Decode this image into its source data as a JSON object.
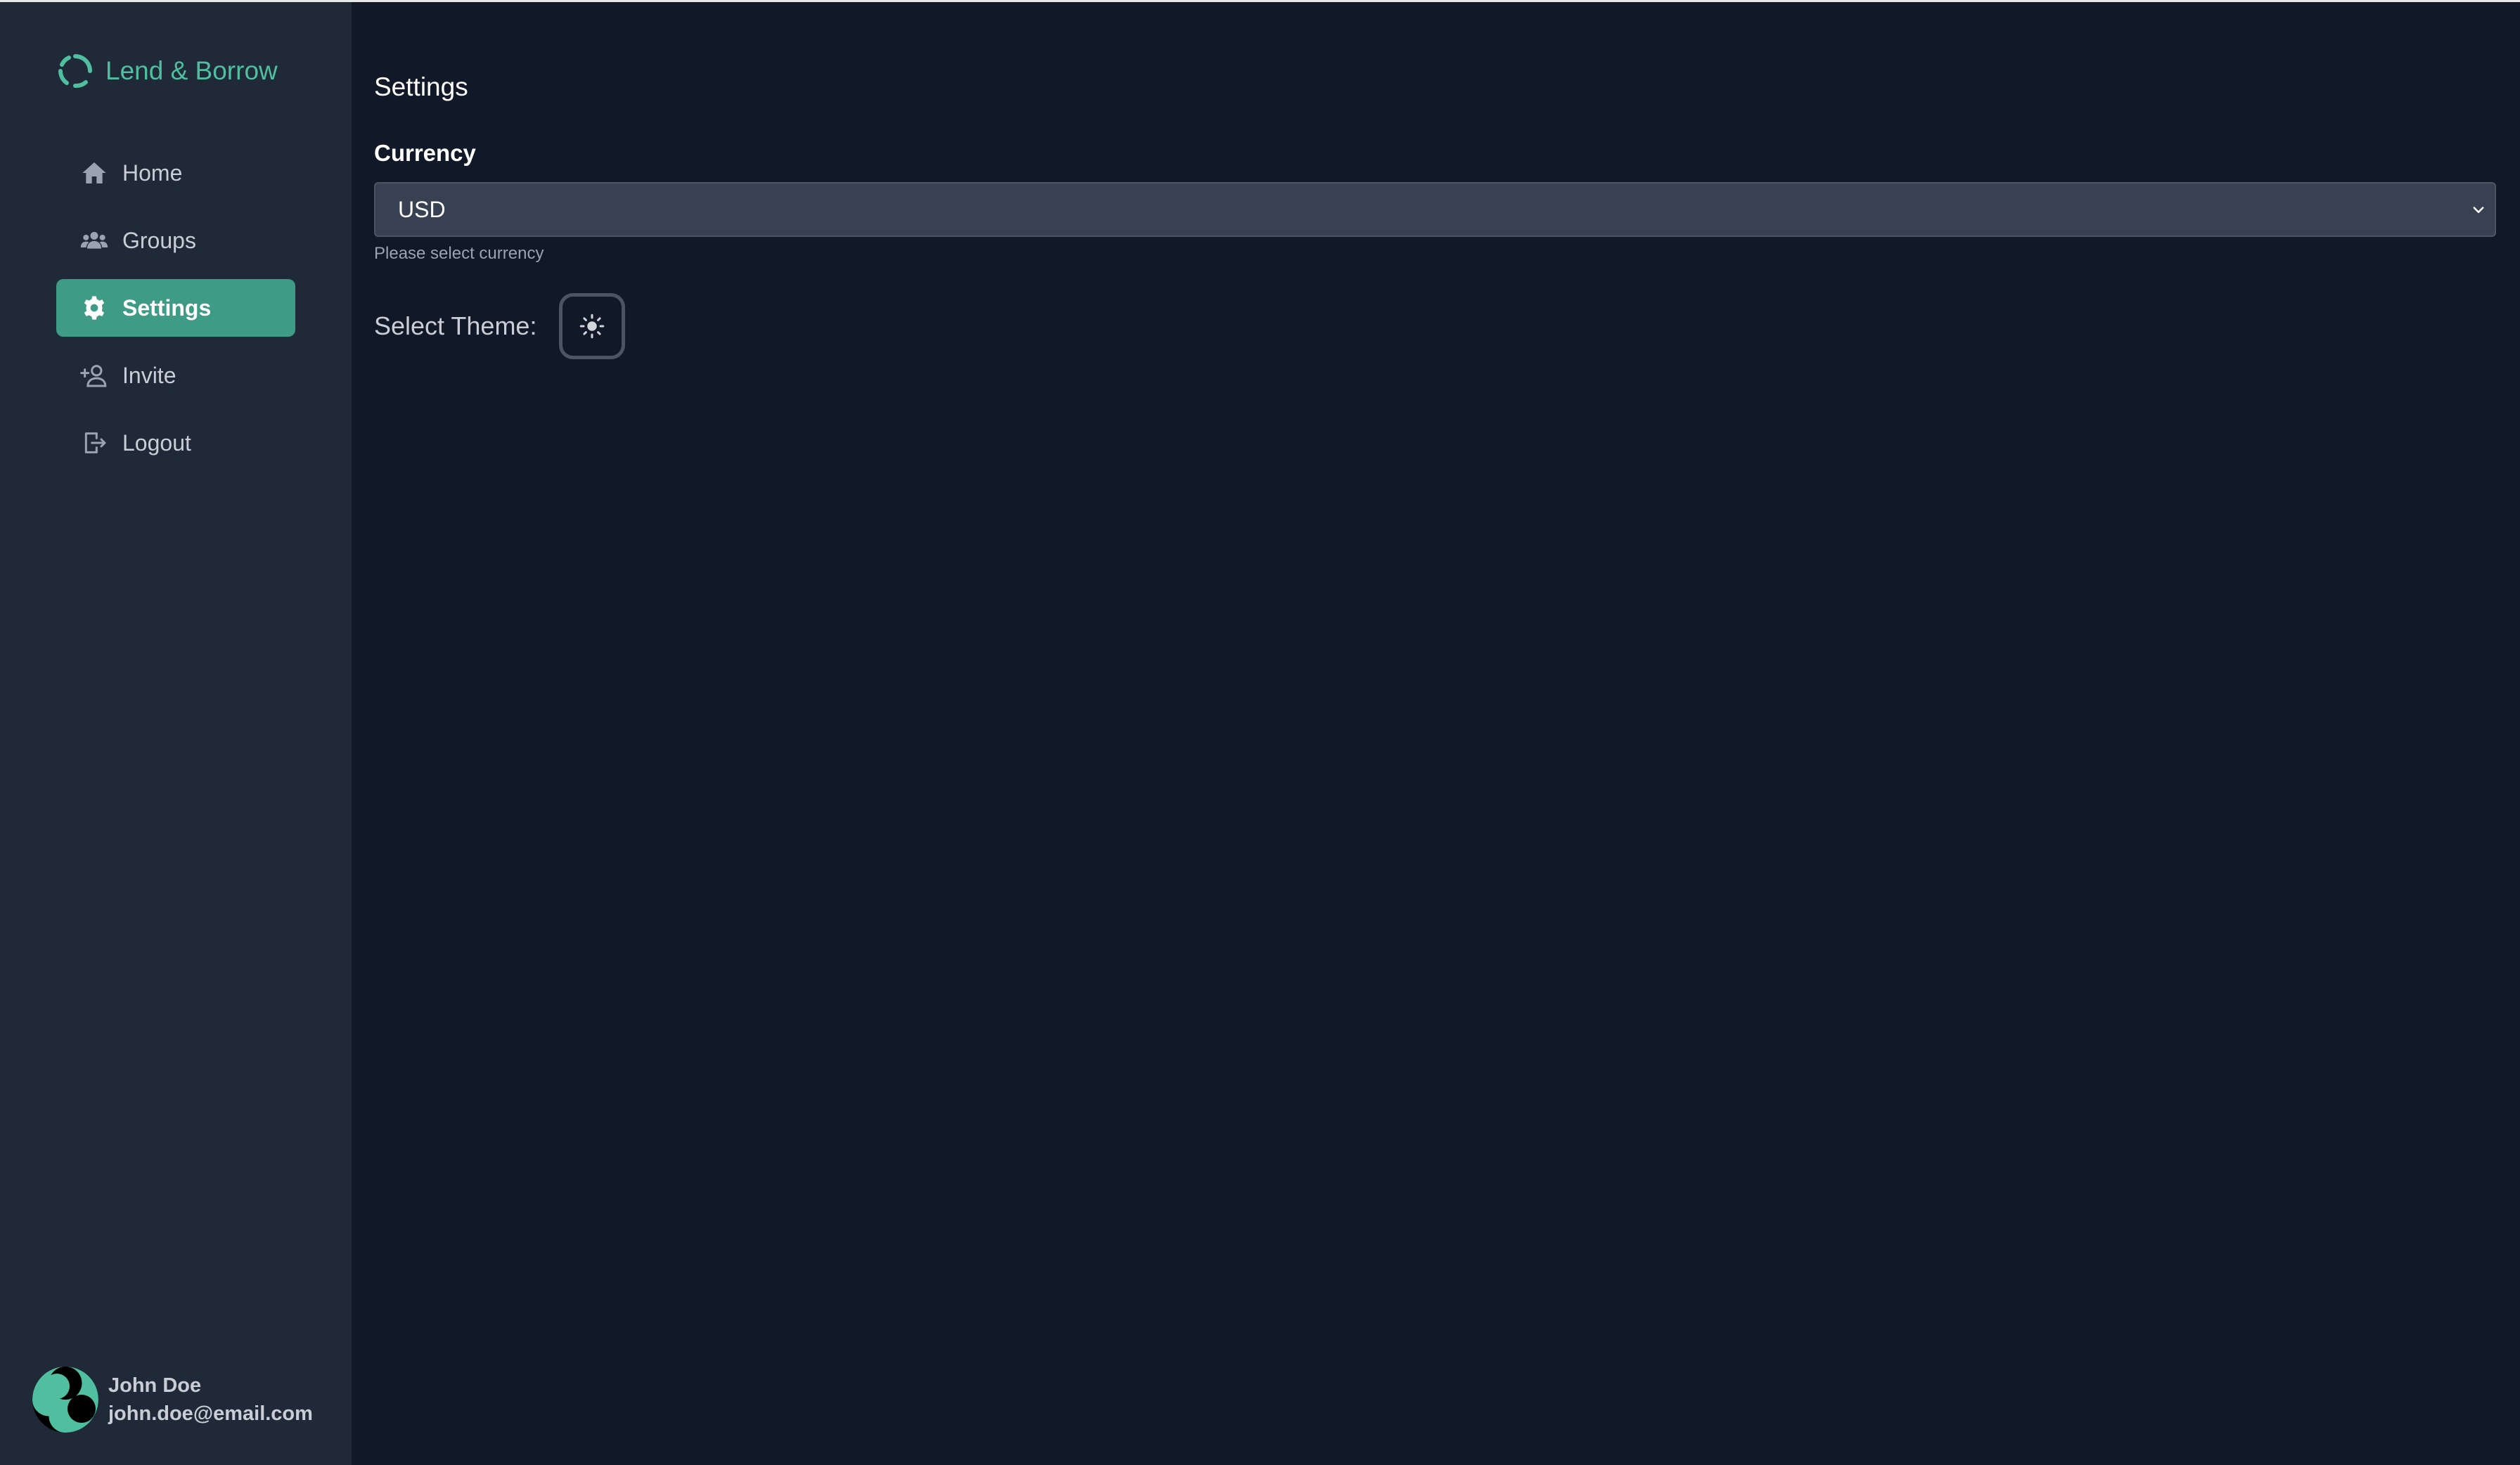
{
  "app": {
    "name": "Lend & Borrow",
    "accent_color": "#3d9b86",
    "brand_color": "#4fbf9f"
  },
  "sidebar": {
    "items": [
      {
        "label": "Home",
        "icon": "home-icon",
        "active": false
      },
      {
        "label": "Groups",
        "icon": "users-icon",
        "active": false
      },
      {
        "label": "Settings",
        "icon": "gear-icon",
        "active": true
      },
      {
        "label": "Invite",
        "icon": "user-plus-icon",
        "active": false
      },
      {
        "label": "Logout",
        "icon": "logout-icon",
        "active": false
      }
    ],
    "user": {
      "name": "John Doe",
      "email": "john.doe@email.com"
    }
  },
  "main": {
    "title": "Settings",
    "currency": {
      "label": "Currency",
      "value": "USD",
      "hint": "Please select currency"
    },
    "theme": {
      "label": "Select Theme:",
      "icon": "sun-icon"
    }
  }
}
